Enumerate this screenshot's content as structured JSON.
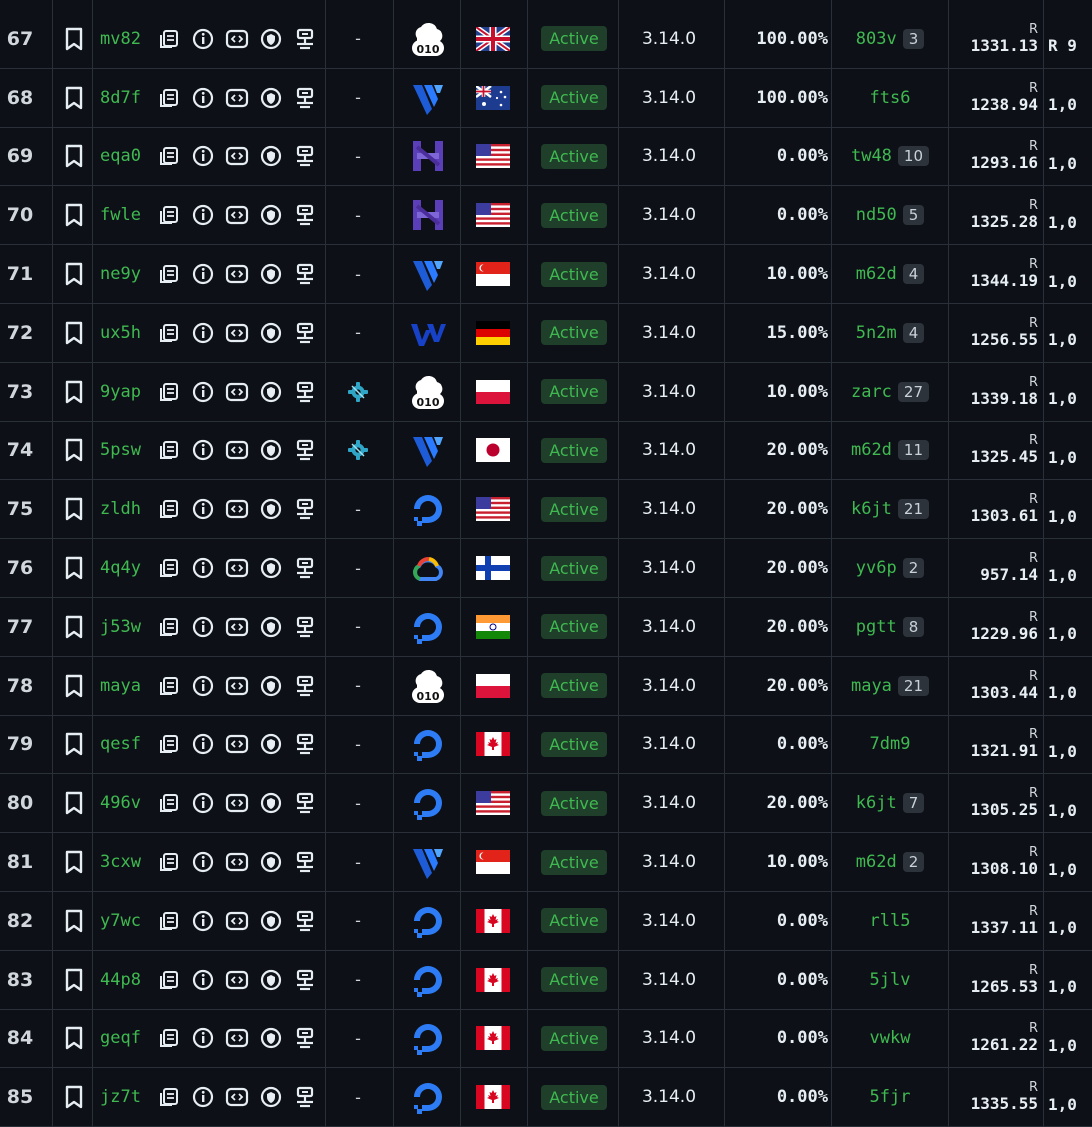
{
  "colors": {
    "background": "#0d1117",
    "accent_green": "#3fb950",
    "status_bg": "#1f3f2a",
    "grid": "#2a3038"
  },
  "status_label": "Active",
  "rows": [
    {
      "n": "67",
      "id": "mv82",
      "provider": "cloud010-icon",
      "country": "gb",
      "version": "3.14.0",
      "pct": "100.00%",
      "owner": "803v",
      "count": "3",
      "currency": "R",
      "price": "1331.13",
      "extra": "R 9"
    },
    {
      "n": "68",
      "id": "8d7f",
      "provider": "vultr-icon",
      "country": "au",
      "version": "3.14.0",
      "pct": "100.00%",
      "owner": "fts6",
      "count": "",
      "currency": "R",
      "price": "1238.94",
      "extra": "1,0"
    },
    {
      "n": "69",
      "id": "eqa0",
      "provider": "hetzner-icon",
      "country": "us",
      "version": "3.14.0",
      "pct": "0.00%",
      "owner": "tw48",
      "count": "10",
      "currency": "R",
      "price": "1293.16",
      "extra": "1,0"
    },
    {
      "n": "70",
      "id": "fwle",
      "provider": "hetzner-icon",
      "country": "us",
      "version": "3.14.0",
      "pct": "0.00%",
      "owner": "nd50",
      "count": "5",
      "currency": "R",
      "price": "1325.28",
      "extra": "1,0"
    },
    {
      "n": "71",
      "id": "ne9y",
      "provider": "vultr-icon",
      "country": "sg",
      "version": "3.14.0",
      "pct": "10.00%",
      "owner": "m62d",
      "count": "4",
      "currency": "R",
      "price": "1344.19",
      "extra": "1,0"
    },
    {
      "n": "72",
      "id": "ux5h",
      "provider": "vw-icon",
      "country": "de",
      "version": "3.14.0",
      "pct": "15.00%",
      "owner": "5n2m",
      "count": "4",
      "currency": "R",
      "price": "1256.55",
      "extra": "1,0"
    },
    {
      "n": "73",
      "id": "9yap",
      "provider": "cloud010-icon",
      "country": "pl",
      "version": "3.14.0",
      "pct": "10.00%",
      "owner": "zarc",
      "count": "27",
      "currency": "R",
      "price": "1339.18",
      "extra": "1,0",
      "gear": true
    },
    {
      "n": "74",
      "id": "5psw",
      "provider": "vultr-icon",
      "country": "jp",
      "version": "3.14.0",
      "pct": "20.00%",
      "owner": "m62d",
      "count": "11",
      "currency": "R",
      "price": "1325.45",
      "extra": "1,0",
      "gear": true
    },
    {
      "n": "75",
      "id": "zldh",
      "provider": "digitalocean-icon",
      "country": "us",
      "version": "3.14.0",
      "pct": "20.00%",
      "owner": "k6jt",
      "count": "21",
      "currency": "R",
      "price": "1303.61",
      "extra": "1,0"
    },
    {
      "n": "76",
      "id": "4q4y",
      "provider": "google-cloud-icon",
      "country": "fi",
      "version": "3.14.0",
      "pct": "20.00%",
      "owner": "yv6p",
      "count": "2",
      "currency": "R",
      "price": "957.14",
      "extra": "1,0"
    },
    {
      "n": "77",
      "id": "j53w",
      "provider": "digitalocean-icon",
      "country": "in",
      "version": "3.14.0",
      "pct": "20.00%",
      "owner": "pgtt",
      "count": "8",
      "currency": "R",
      "price": "1229.96",
      "extra": "1,0"
    },
    {
      "n": "78",
      "id": "maya",
      "provider": "cloud010-icon",
      "country": "pl",
      "version": "3.14.0",
      "pct": "20.00%",
      "owner": "maya",
      "count": "21",
      "currency": "R",
      "price": "1303.44",
      "extra": "1,0"
    },
    {
      "n": "79",
      "id": "qesf",
      "provider": "digitalocean-icon",
      "country": "ca",
      "version": "3.14.0",
      "pct": "0.00%",
      "owner": "7dm9",
      "count": "",
      "currency": "R",
      "price": "1321.91",
      "extra": "1,0"
    },
    {
      "n": "80",
      "id": "496v",
      "provider": "digitalocean-icon",
      "country": "us",
      "version": "3.14.0",
      "pct": "20.00%",
      "owner": "k6jt",
      "count": "7",
      "currency": "R",
      "price": "1305.25",
      "extra": "1,0"
    },
    {
      "n": "81",
      "id": "3cxw",
      "provider": "vultr-icon",
      "country": "sg",
      "version": "3.14.0",
      "pct": "10.00%",
      "owner": "m62d",
      "count": "2",
      "currency": "R",
      "price": "1308.10",
      "extra": "1,0"
    },
    {
      "n": "82",
      "id": "y7wc",
      "provider": "digitalocean-icon",
      "country": "ca",
      "version": "3.14.0",
      "pct": "0.00%",
      "owner": "rll5",
      "count": "",
      "currency": "R",
      "price": "1337.11",
      "extra": "1,0"
    },
    {
      "n": "83",
      "id": "44p8",
      "provider": "digitalocean-icon",
      "country": "ca",
      "version": "3.14.0",
      "pct": "0.00%",
      "owner": "5jlv",
      "count": "",
      "currency": "R",
      "price": "1265.53",
      "extra": "1,0"
    },
    {
      "n": "84",
      "id": "geqf",
      "provider": "digitalocean-icon",
      "country": "ca",
      "version": "3.14.0",
      "pct": "0.00%",
      "owner": "vwkw",
      "count": "",
      "currency": "R",
      "price": "1261.22",
      "extra": "1,0"
    },
    {
      "n": "85",
      "id": "jz7t",
      "provider": "digitalocean-icon",
      "country": "ca",
      "version": "3.14.0",
      "pct": "0.00%",
      "owner": "5fjr",
      "count": "",
      "currency": "R",
      "price": "1335.55",
      "extra": "1,0"
    }
  ]
}
